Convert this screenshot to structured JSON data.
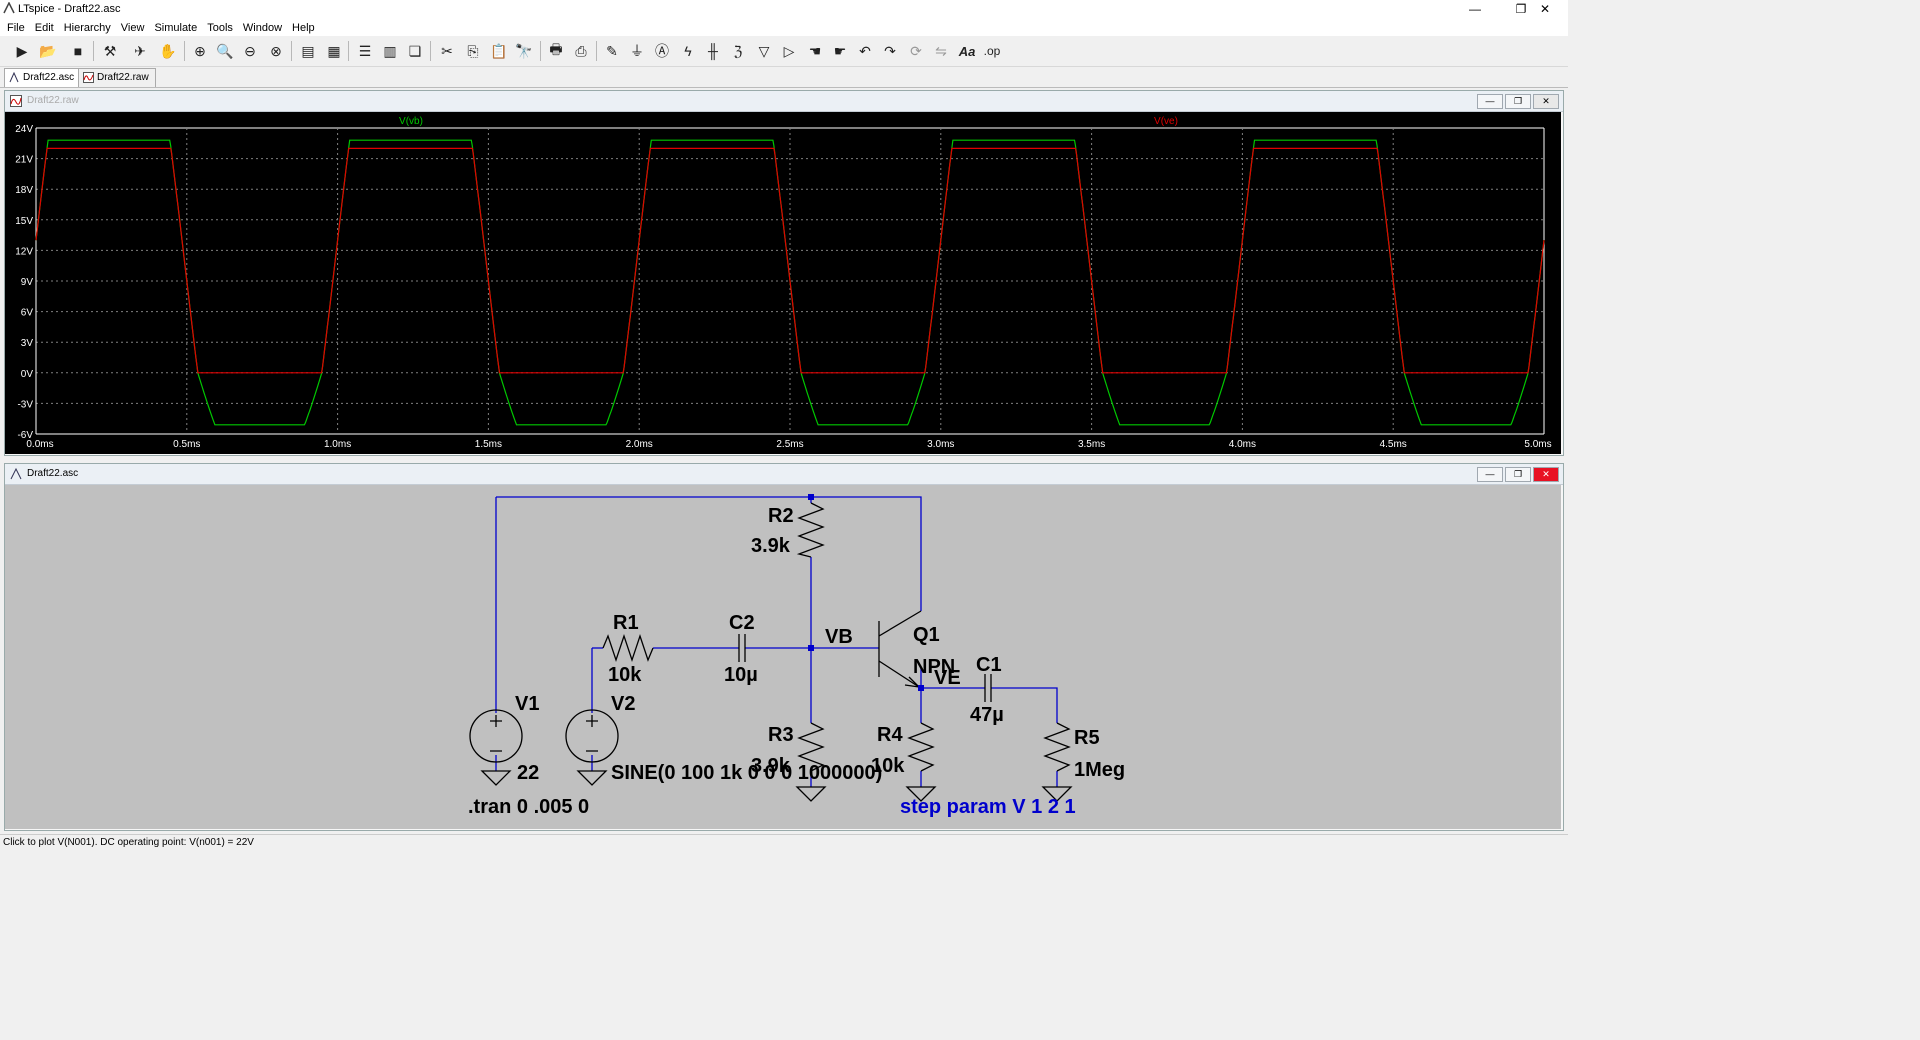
{
  "window": {
    "title": "LTspice - Draft22.asc",
    "min": "—",
    "max": "❐",
    "close": "✕"
  },
  "menu": [
    "File",
    "Edit",
    "Hierarchy",
    "View",
    "Simulate",
    "Tools",
    "Window",
    "Help"
  ],
  "toolbar": {
    "icons": [
      "run-icon",
      "open-icon",
      "save-icon",
      "control-panel-icon",
      "halt-icon",
      "pan-icon",
      "zoom-in-icon",
      "zoom-area-icon",
      "zoom-out-icon",
      "zoom-fit-icon",
      "autorange-icon",
      "grid-icon",
      "tile-horizontal-icon",
      "tile-vertical-icon",
      "cascade-icon",
      "cut-icon",
      "copy-icon",
      "paste-icon",
      "find-icon",
      "print-icon",
      "print-setup-icon",
      "wire-icon",
      "ground-icon",
      "label-icon",
      "resistor-icon",
      "capacitor-icon",
      "inductor-icon",
      "diode-icon",
      "component-icon",
      "move-icon",
      "drag-icon",
      "undo-icon",
      "redo-icon",
      "rotate-icon",
      "mirror-icon",
      "text-icon",
      "spice-directive-icon"
    ],
    "text_tool": "Aa",
    "op_tool": ".op"
  },
  "tabs": [
    {
      "label": "Draft22.asc",
      "active": true
    },
    {
      "label": "Draft22.raw",
      "active": false
    }
  ],
  "plot_window": {
    "title": "Draft22.raw",
    "traces": [
      {
        "name": "V(vb)",
        "color": "#00c800"
      },
      {
        "name": "V(ve)",
        "color": "#e00000"
      }
    ],
    "y_ticks": [
      "24V",
      "21V",
      "18V",
      "15V",
      "12V",
      "9V",
      "6V",
      "3V",
      "0V",
      "-3V",
      "-6V"
    ],
    "x_ticks": [
      "0.0ms",
      "0.5ms",
      "1.0ms",
      "1.5ms",
      "2.0ms",
      "2.5ms",
      "3.0ms",
      "3.5ms",
      "4.0ms",
      "4.5ms",
      "5.0ms"
    ]
  },
  "chart_data": {
    "type": "line",
    "xlabel": "",
    "ylabel": "",
    "xlim_ms": [
      0,
      5
    ],
    "ylim_V": [
      -6,
      24
    ],
    "grid": true,
    "series": [
      {
        "name": "V(vb)",
        "color": "#00c800",
        "period_ms": 1,
        "max_V": 22.8,
        "min_V": -5.1,
        "offset_V": 11
      },
      {
        "name": "V(ve)",
        "color": "#e00000",
        "period_ms": 1,
        "max_V": 22.0,
        "min_V": 0.0,
        "offset_V": 11
      }
    ]
  },
  "schematic_window": {
    "title": "Draft22.asc",
    "labels": {
      "r2": "R2",
      "r2v": "3.9k",
      "r1": "R1",
      "r1v": "10k",
      "c2": "C2",
      "c2v": "10µ",
      "vb": "VB",
      "q1": "Q1",
      "q1v": "NPN",
      "c1": "C1",
      "c1v": "47µ",
      "ve": "VE",
      "v1": "V1",
      "v1v": "22",
      "v2": "V2",
      "v2v": "SINE(0 100 1k 0 0 0 1000000)",
      "r3": "R3",
      "r3v": "3.9k",
      "r4": "R4",
      "r4v": "10k",
      "r5": "R5",
      "r5v": "1Meg",
      "tran": ".tran 0 .005 0",
      "step": "step param V 1 2 1"
    }
  },
  "status": "Click to plot V(N001).  DC operating point: V(n001) = 22V"
}
